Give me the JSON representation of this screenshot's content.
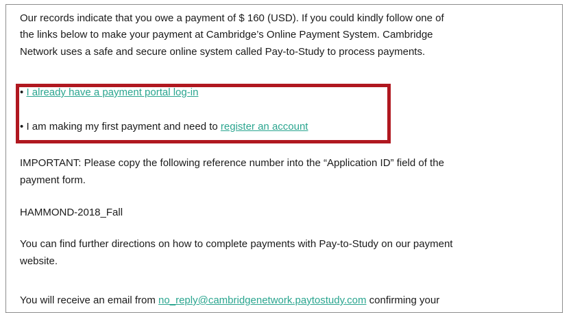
{
  "intro": {
    "line1": "Our records indicate that you owe a payment of $ 160 (USD). If you could kindly follow one of",
    "line2": "the links below to make your payment at Cambridge’s Online Payment System. Cambridge",
    "line3": "Network uses a safe and secure online system called Pay-to-Study to process payments."
  },
  "options": {
    "bullet": "•",
    "login_link": "I already have a payment portal log-in",
    "first_payment_text": "I am making my first payment and need to",
    "register_link": "register an account"
  },
  "important": {
    "line1": "IMPORTANT: Please copy the following reference number into the “Application ID” field of the",
    "line2": "payment form."
  },
  "reference": "HAMMOND-2018_Fall",
  "directions": {
    "line1": "You can find further directions on how to complete payments with Pay-to-Study on our payment",
    "line2": "website."
  },
  "confirmation": {
    "prefix": "You will receive an email from",
    "email_link": "no_reply@cambridgenetwork.paytostudy.com",
    "suffix": "confirming your"
  },
  "colors": {
    "link": "#2aa58f",
    "highlight_border": "#b01820",
    "panel_border": "#8c8c8c"
  }
}
